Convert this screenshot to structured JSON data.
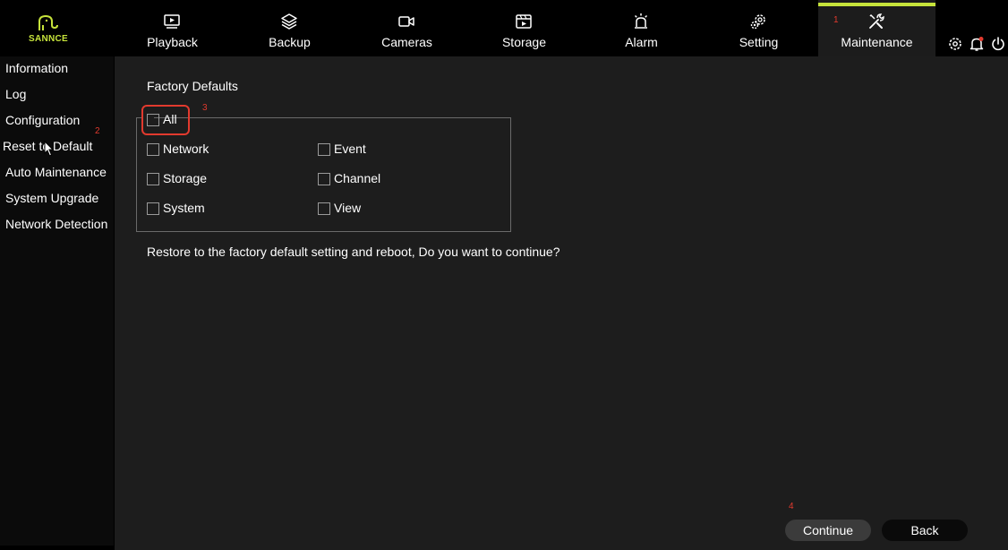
{
  "brand": {
    "logo_text": "SANNCE"
  },
  "tabs": [
    {
      "label": "Playback",
      "icon": "playback-icon"
    },
    {
      "label": "Backup",
      "icon": "layers-icon"
    },
    {
      "label": "Cameras",
      "icon": "camera-icon"
    },
    {
      "label": "Storage",
      "icon": "film-storage-icon"
    },
    {
      "label": "Alarm",
      "icon": "alarm-siren-icon"
    },
    {
      "label": "Setting",
      "icon": "gears-icon"
    },
    {
      "label": "Maintenance",
      "icon": "tools-icon",
      "active": true
    }
  ],
  "header_icons": [
    "settings-gear-icon",
    "notification-bell-icon",
    "power-icon"
  ],
  "sidebar": {
    "items": [
      {
        "label": "Information"
      },
      {
        "label": "Log"
      },
      {
        "label": "Configuration"
      },
      {
        "label": "Reset to Default",
        "active": true
      },
      {
        "label": "Auto Maintenance"
      },
      {
        "label": "System Upgrade"
      },
      {
        "label": "Network Detection"
      }
    ]
  },
  "main": {
    "section_title": "Factory Defaults",
    "all_label": "All",
    "options_left": [
      "Network",
      "Storage",
      "System"
    ],
    "options_right": [
      "Event",
      "Channel",
      "View"
    ],
    "message": "Restore to the factory default setting and reboot, Do you want to continue?",
    "continue_label": "Continue",
    "back_label": "Back"
  },
  "annotations": {
    "a1": "1",
    "a2": "2",
    "a3": "3",
    "a4": "4"
  },
  "colors": {
    "accent": "#c6e33b",
    "highlight": "#e23a2e",
    "panel": "#1d1d1d"
  }
}
